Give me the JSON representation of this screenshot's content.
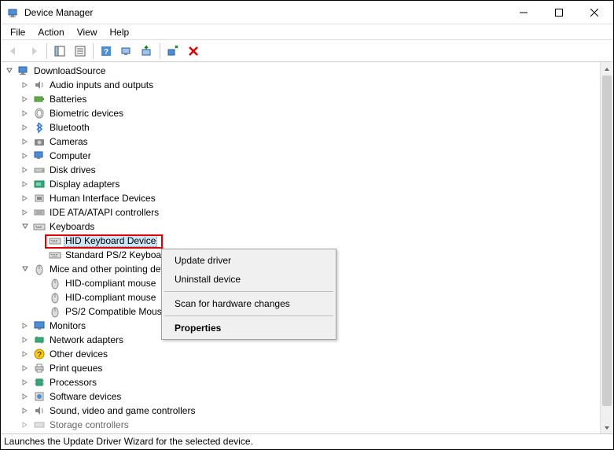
{
  "window": {
    "title": "Device Manager"
  },
  "menu": {
    "file": "File",
    "action": "Action",
    "view": "View",
    "help": "Help"
  },
  "tree": {
    "root": "DownloadSource",
    "items": [
      "Audio inputs and outputs",
      "Batteries",
      "Biometric devices",
      "Bluetooth",
      "Cameras",
      "Computer",
      "Disk drives",
      "Display adapters",
      "Human Interface Devices",
      "IDE ATA/ATAPI controllers",
      "Keyboards",
      "Mice and other pointing devices",
      "Monitors",
      "Network adapters",
      "Other devices",
      "Print queues",
      "Processors",
      "Software devices",
      "Sound, video and game controllers",
      "Storage controllers"
    ],
    "keyboards_children": [
      "HID Keyboard Device",
      "Standard PS/2 Keyboard"
    ],
    "mice_children": [
      "HID-compliant mouse",
      "HID-compliant mouse",
      "PS/2 Compatible Mouse"
    ]
  },
  "context_menu": {
    "update": "Update driver",
    "uninstall": "Uninstall device",
    "scan": "Scan for hardware changes",
    "properties": "Properties"
  },
  "status": "Launches the Update Driver Wizard for the selected device."
}
